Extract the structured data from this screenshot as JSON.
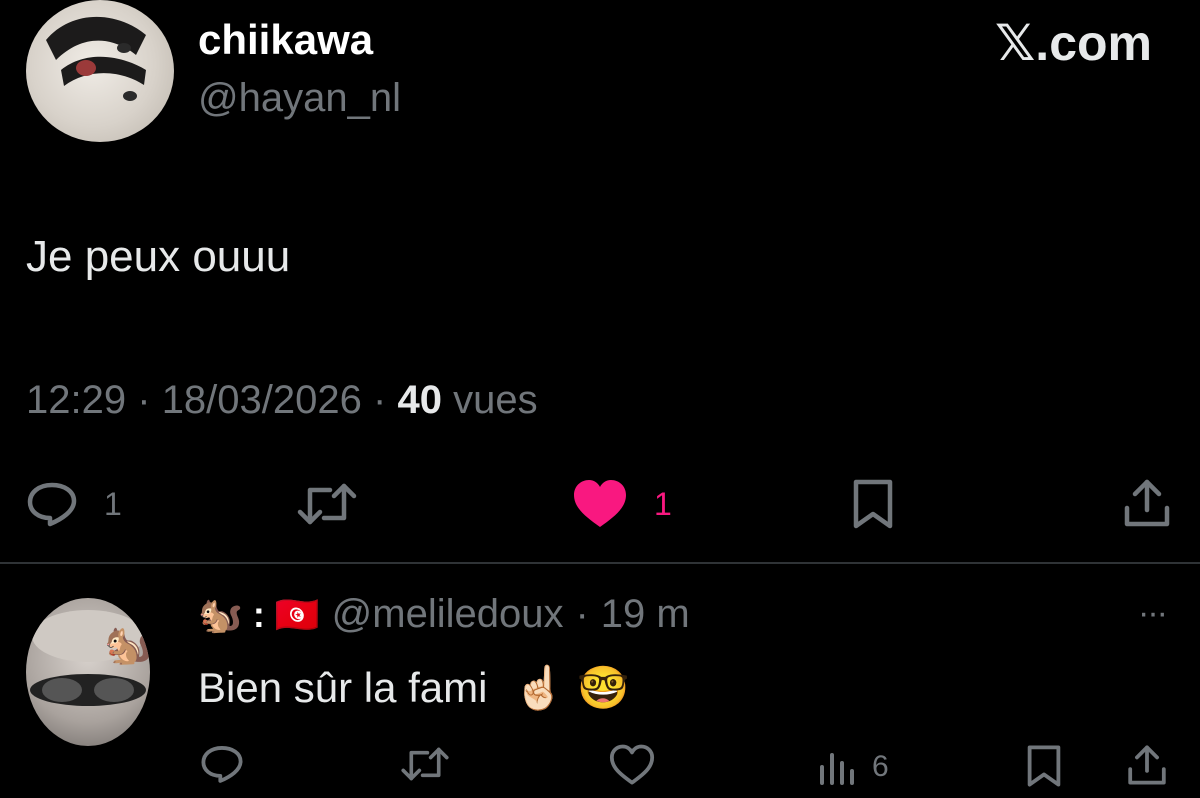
{
  "tweet": {
    "display_name": "chiikawa",
    "handle": "@hayan_nl",
    "brand": "𝕏.com",
    "text": "Je peux ouuu",
    "time": "12:29",
    "sep1": "·",
    "date": "18/03/2026",
    "sep2": "·",
    "views_count": "40",
    "views_label": "vues",
    "reply_count": "1",
    "like_count": "1",
    "like_color": "#f91880"
  },
  "reply": {
    "display_name": "🐿️ : 🇹🇳",
    "handle": "@meliledoux",
    "sep": "·",
    "time": "19 m",
    "more": "···",
    "text": "Bien sûr la fami",
    "emojis": "☝🏻 🤓",
    "views_count": "6"
  },
  "colors": {
    "background": "#000000",
    "text": "#e7e9ea",
    "muted": "#71767b",
    "divider": "#2f3336"
  }
}
